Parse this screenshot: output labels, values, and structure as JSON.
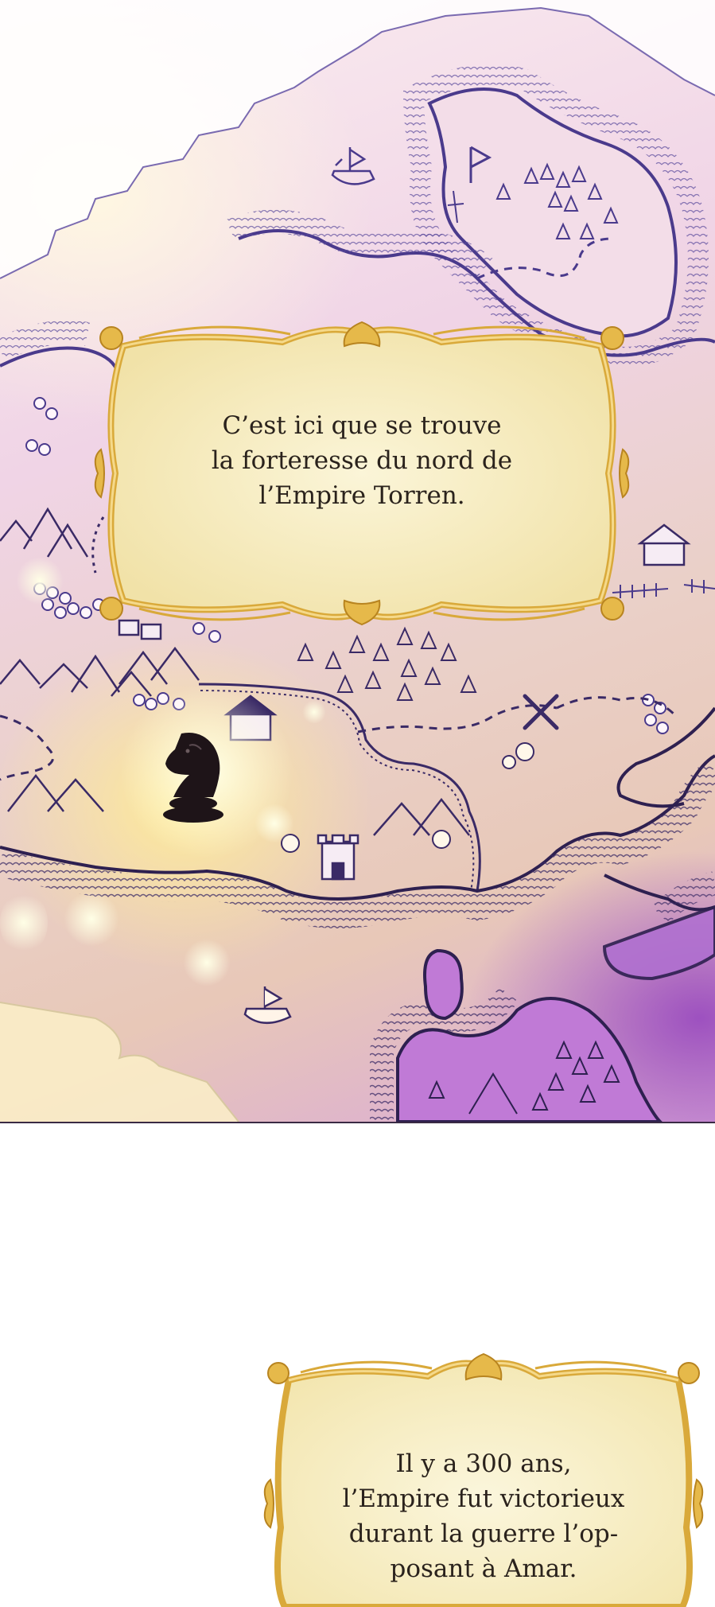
{
  "caption_1": {
    "lines": [
      "C’est ici que se trouve",
      "la forteresse du nord de",
      "l’Empire Torren."
    ]
  },
  "caption_2": {
    "lines": [
      "Il y a 300 ans,",
      "l’Empire fut victorieux",
      "durant la guerre l’op-",
      "posant à Amar."
    ]
  },
  "map": {
    "icons": [
      "ship-icon",
      "flag-icon",
      "forest-icon",
      "mountain-icon",
      "village-icon",
      "crossed-swords-icon",
      "tower-icon",
      "chess-knight-icon"
    ]
  },
  "colors": {
    "ink": "#4a3a8c",
    "frame_gold": "#d9a93a",
    "caption_bg": "#f8efc6",
    "purple_sea": "#9a4cc0"
  }
}
